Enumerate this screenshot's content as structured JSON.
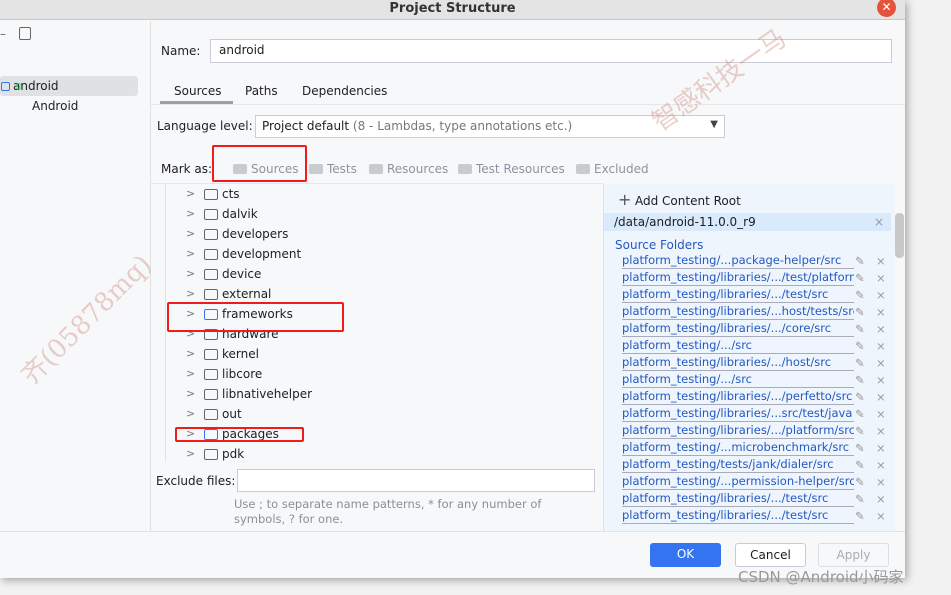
{
  "window": {
    "title": "Project Structure",
    "close_icon": "close-icon"
  },
  "left": {
    "items": [
      {
        "label": "android"
      },
      {
        "label": "Android"
      }
    ]
  },
  "name": {
    "label": "Name:",
    "value": "android"
  },
  "tabs": [
    {
      "label": "Sources"
    },
    {
      "label": "Paths"
    },
    {
      "label": "Dependencies"
    }
  ],
  "language": {
    "label": "Language level:",
    "value": "Project default",
    "hint": "(8 - Lambdas, type annotations etc.)"
  },
  "mark_as": {
    "label": "Mark as:",
    "options": [
      "Sources",
      "Tests",
      "Resources",
      "Test Resources",
      "Excluded"
    ]
  },
  "tree": [
    "cts",
    "dalvik",
    "developers",
    "development",
    "device",
    "external",
    "frameworks",
    "hardware",
    "kernel",
    "libcore",
    "libnativehelper",
    "out",
    "packages",
    "pdk"
  ],
  "right": {
    "add_root": "Add Content Root",
    "root": "/data/android-11.0.0_r9",
    "section": "Source Folders",
    "folders": [
      "platform_testing/...package-helper/src",
      "platform_testing/libraries/.../test/platform",
      "platform_testing/libraries/.../test/src",
      "platform_testing/libraries/...host/tests/src",
      "platform_testing/libraries/.../core/src",
      "platform_testing/.../src",
      "platform_testing/libraries/.../host/src",
      "platform_testing/.../src",
      "platform_testing/libraries/.../perfetto/src",
      "platform_testing/libraries/...src/test/java",
      "platform_testing/libraries/.../platform/src",
      "platform_testing/...microbenchmark/src",
      "platform_testing/tests/jank/dialer/src",
      "platform_testing/...permission-helper/src",
      "platform_testing/libraries/.../test/src",
      "platform_testing/libraries/.../test/src"
    ]
  },
  "exclude": {
    "label": "Exclude files:",
    "value": "",
    "help": "Use ; to separate name patterns, * for any number of symbols, ? for one."
  },
  "buttons": {
    "ok": "OK",
    "cancel": "Cancel",
    "apply": "Apply"
  },
  "watermark": {
    "csdn": "CSDN @Android小码家",
    "text1": "智感科技一马",
    "text2": "齐(05878mq)"
  },
  "colors": {
    "accent": "#3574f0",
    "link": "#2358c1",
    "annotation": "#f21b1b"
  }
}
